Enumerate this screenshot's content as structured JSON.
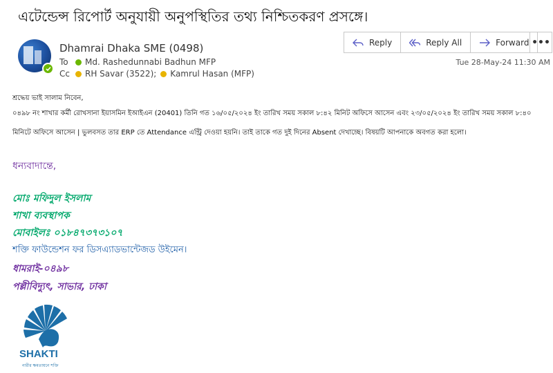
{
  "subject": "এটেন্ডেন্স রিপোর্ট অনুযায়ী অনুপস্থিতির তথ্য নিশ্চিতকরণ প্রসঙ্গে।",
  "sender": {
    "name": "Dhamrai Dhaka SME (0498)"
  },
  "to": {
    "label": "To",
    "recipient": "Md. Rashedunnabi Badhun MFP"
  },
  "cc": {
    "label": "Cc",
    "recipient1": "RH Savar (3522);",
    "recipient2": "Kamrul Hasan (MFP)"
  },
  "toolbar": {
    "reply": "Reply",
    "reply_all": "Reply All",
    "forward": "Forward",
    "more": "•••"
  },
  "date": "Tue 28-May-24 11:30 AM",
  "body": {
    "line1": "শ্রদ্ধেয় ভাই সালাম নিবেন,",
    "line2": "০৪৯৮ নং শাখার কর্মী রোখসানা ইয়াসমিন ইআইএন (20401) তিনি  গত ১৬/০৫/২০২৪ ইং তারিখ সময় সকাল ৮:৪২ মিনিট অফিসে আসেন  এবং ২৩/০৫/২০২৪ ইং তারিখ সময় সকাল ৮:৪০",
    "line3": "মিনিটে অফিসে আসেন |  ভুলবসত তার  ERP তে Attendance এন্ট্রি দেওয়া হয়নি। তাই তাকে গত দুই দিনের Absent দেখাচ্ছে। বিষয়টি আপনাকে অবগত করা হলো।",
    "thanks": "ধন্যবাদান্তে,"
  },
  "signature": {
    "name": "মোঃ মফিদুল ইসলাম",
    "title": "শাখা ব্যবস্থাপক",
    "mobile": "মোবাইলঃ ০১৮৪৭৩৭৩১০৭",
    "org": "শক্তি ফাউন্ডেশন ফর ডিসএ্যাডভান্টেজড উইমেন।",
    "branch": "ধামরাই-০৪৯৮",
    "address": "পল্লীবিদ্যুৎ, সাভার, ঢাকা"
  },
  "logo": {
    "name": "SHAKTI",
    "tagline": "নারীর ক্ষমতায়নে শক্তি"
  },
  "colors": {
    "presence": "#6bb700",
    "cc_dot": "#e8b400",
    "sig_green": "#00a86b",
    "sig_purple": "#7030a0",
    "logo_blue": "#1d6fa8"
  }
}
